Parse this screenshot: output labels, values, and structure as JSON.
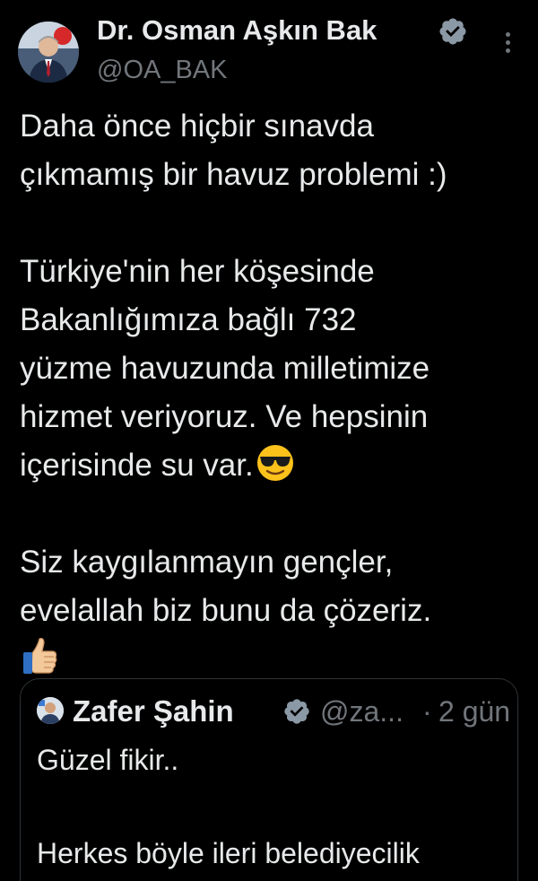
{
  "author": {
    "name": "Dr. Osman Aşkın Bak",
    "handle": "@OA_BAK",
    "verified_icon": "verified-badge-icon"
  },
  "tweet": {
    "lines": [
      "Daha önce hiçbir sınavda",
      "çıkmamış bir havuz problemi :)",
      "",
      "Türkiye'nin her köşesinde",
      "Bakanlığımıza bağlı 732",
      "yüzme havuzunda milletimize",
      "hizmet veriyoruz. Ve hepsinin",
      "içerisinde su var.",
      "",
      "Siz kaygılanmayın gençler,",
      "evelallah biz bunu da çözeriz."
    ],
    "emoji_after_line_8": "smiling-face-with-sunglasses",
    "emoji_last_line": "thumbs-up"
  },
  "quoted_tweet": {
    "name": "Zafer Şahin",
    "handle": "@za...",
    "separator": "·",
    "time": "2 gün",
    "lines": [
      "Güzel fikir..",
      "",
      "Herkes böyle ileri belediyecilik"
    ]
  },
  "colors": {
    "background": "#000000",
    "text": "#e7e9ea",
    "muted": "#71767b",
    "verified": "#8b98a5",
    "border": "#2f3336"
  }
}
